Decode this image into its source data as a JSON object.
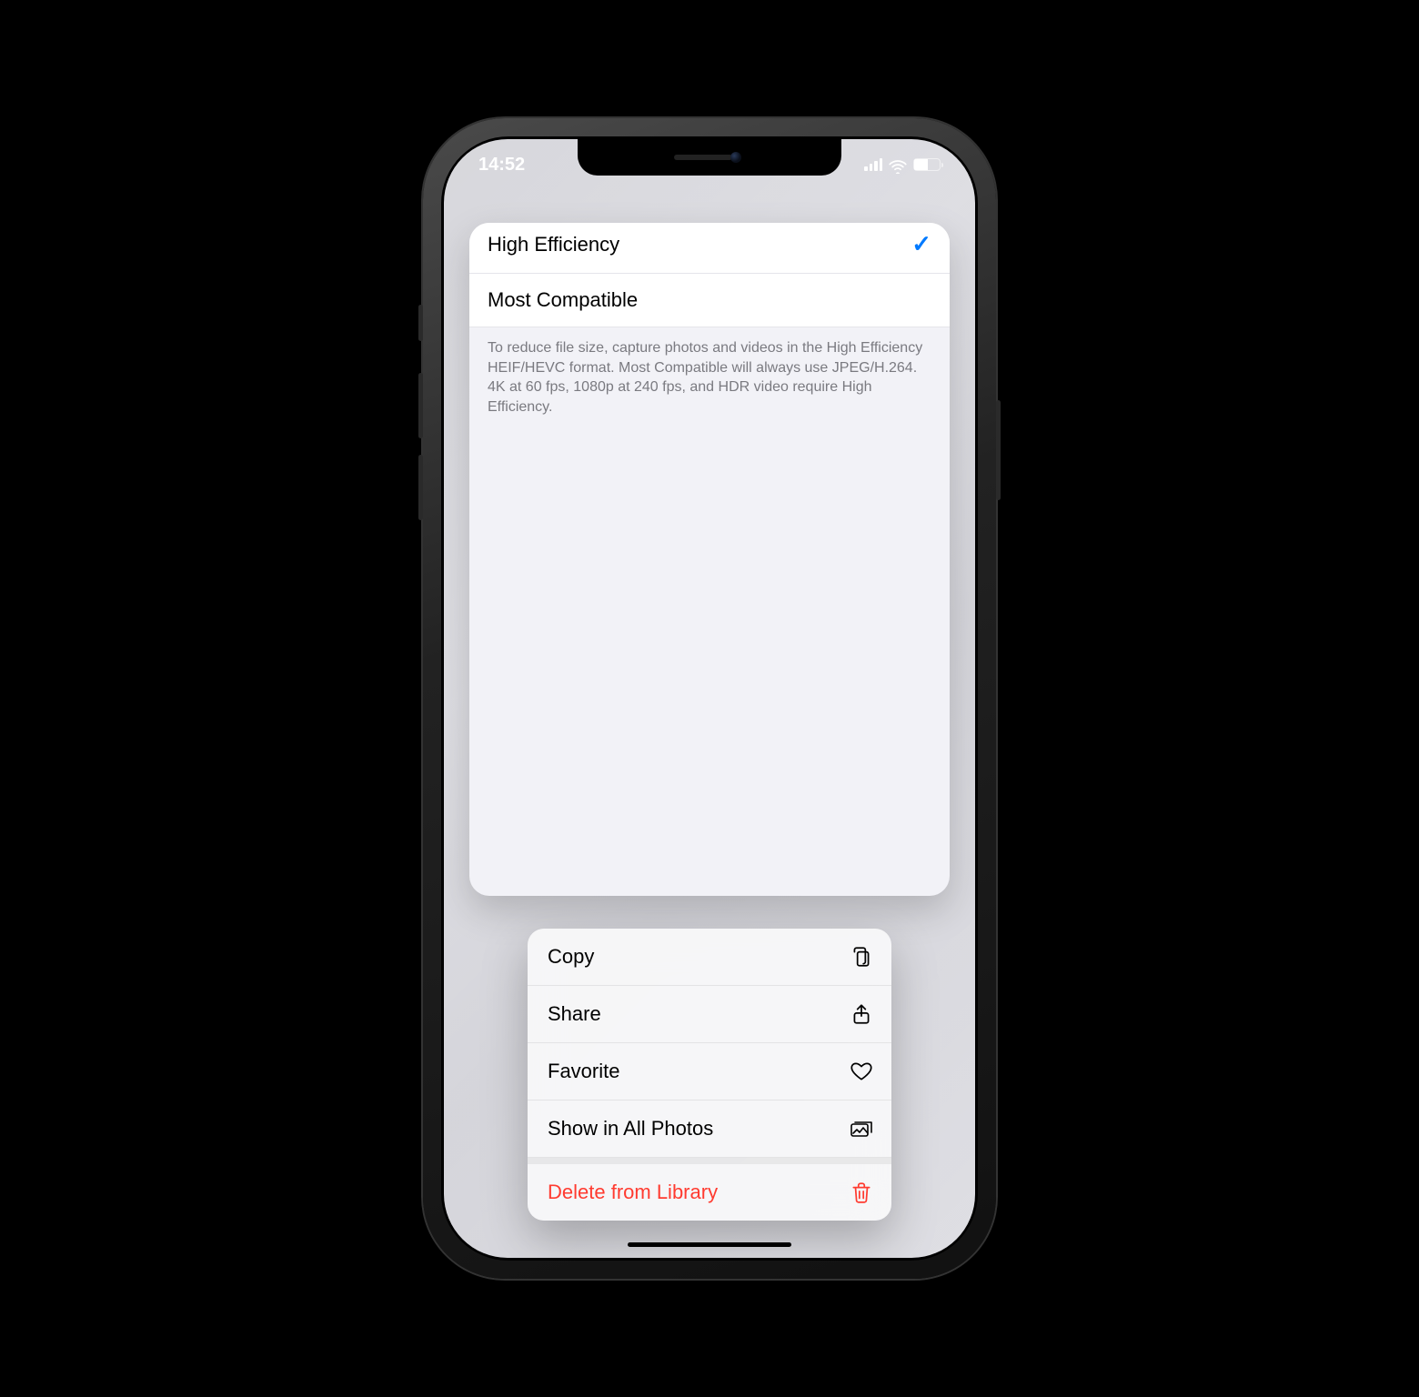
{
  "statusbar": {
    "time": "14:52"
  },
  "preview": {
    "rows": [
      {
        "label": "High Efficiency",
        "checked": true
      },
      {
        "label": "Most Compatible",
        "checked": false
      }
    ],
    "footer": "To reduce file size, capture photos and videos in the High Efficiency HEIF/HEVC format. Most Compatible will always use JPEG/H.264. 4K at 60 fps, 1080p at 240 fps, and HDR video require High Efficiency."
  },
  "context_menu": {
    "items": [
      {
        "label": "Copy",
        "icon": "copy"
      },
      {
        "label": "Share",
        "icon": "share"
      },
      {
        "label": "Favorite",
        "icon": "heart"
      },
      {
        "label": "Show in All Photos",
        "icon": "photos"
      },
      {
        "label": "Delete from Library",
        "icon": "trash",
        "destructive": true,
        "separated": true
      }
    ]
  },
  "colors": {
    "accent": "#007aff",
    "destructive": "#ff3b30"
  }
}
